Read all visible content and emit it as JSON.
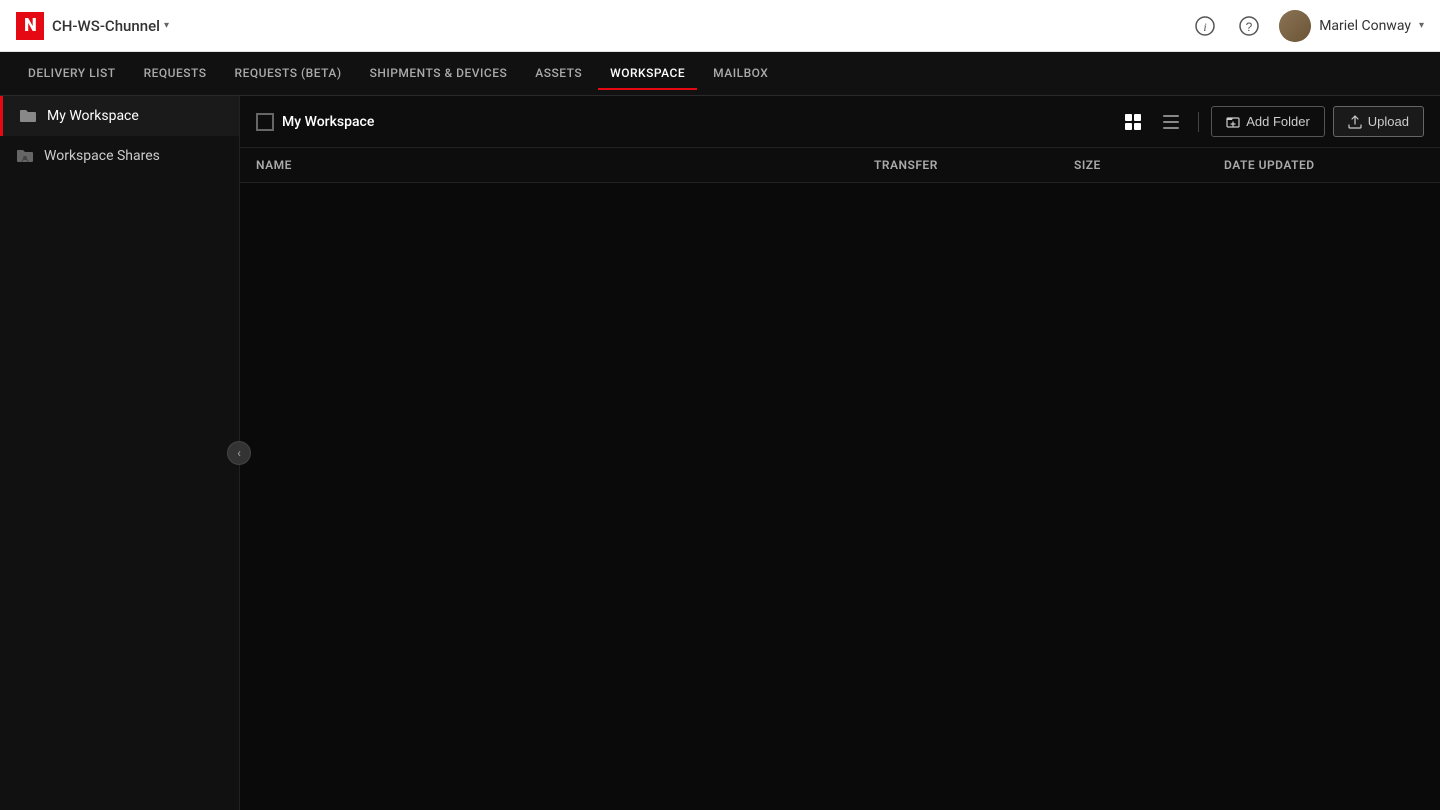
{
  "header": {
    "logo_letter": "N",
    "app_title": "CH-WS-Chunnel",
    "app_title_caret": "▾",
    "info_icon": "ℹ",
    "help_icon": "?",
    "user_name": "Mariel Conway",
    "user_caret": "▾"
  },
  "secondary_nav": {
    "items": [
      {
        "label": "DELIVERY LIST",
        "active": false
      },
      {
        "label": "REQUESTS",
        "active": false
      },
      {
        "label": "REQUESTS (BETA)",
        "active": false
      },
      {
        "label": "SHIPMENTS & DEVICES",
        "active": false
      },
      {
        "label": "ASSETS",
        "active": false
      },
      {
        "label": "WORKSPACE",
        "active": true
      },
      {
        "label": "MAILBOX",
        "active": false
      }
    ]
  },
  "sidebar": {
    "collapse_icon": "‹",
    "items": [
      {
        "label": "My Workspace",
        "icon": "folder",
        "active": true
      },
      {
        "label": "Workspace Shares",
        "icon": "folder-shared",
        "active": false
      }
    ]
  },
  "content": {
    "breadcrumb": "My Workspace",
    "add_folder_label": "Add Folder",
    "upload_label": "Upload",
    "table_headers": {
      "name": "Name",
      "transfer": "Transfer",
      "size": "Size",
      "date_updated": "Date Updated"
    }
  }
}
